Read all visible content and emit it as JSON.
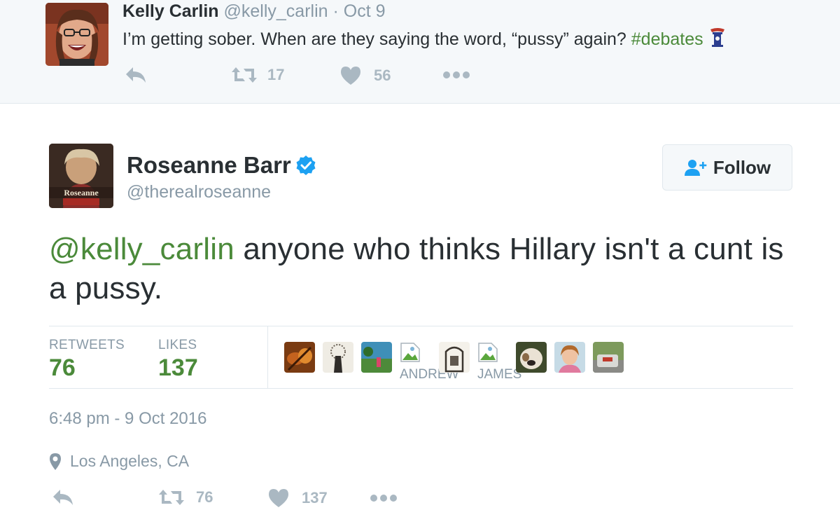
{
  "reply_tweet": {
    "name": "Kelly Carlin",
    "handle": "@kelly_carlin",
    "separator": "·",
    "date": "Oct 9",
    "text": "I’m getting sober.  When are they saying the word, “pussy” again?",
    "hashtag": "#debates",
    "retweet_count": "17",
    "like_count": "56"
  },
  "main_tweet": {
    "name": "Roseanne Barr",
    "handle": "@therealroseanne",
    "follow_label": "Follow",
    "avatar_text": "Roseanne",
    "mention": "@kelly_carlin",
    "text": " anyone who thinks Hillary isn't a cunt is a pussy.",
    "stats": {
      "retweets_label": "RETWEETS",
      "retweets_value": "76",
      "likes_label": "LIKES",
      "likes_value": "137"
    },
    "likers": {
      "name_1": "ANDREW",
      "name_2": "JAMES"
    },
    "timestamp": "6:48 pm - 9 Oct 2016",
    "location": "Los Angeles, CA",
    "retweet_count": "76",
    "like_count": "137"
  },
  "colors": {
    "link_green": "#4b8a3a",
    "muted_gray": "#8899a6",
    "icon_gray": "#aab8c2",
    "verified_blue": "#1da1f2",
    "reply_bg": "#f5f8fa"
  },
  "icons": [
    "reply-icon",
    "retweet-icon",
    "heart-icon",
    "more-icon",
    "verified-icon",
    "follow-person-icon",
    "location-pin-icon",
    "podium-emoji-icon"
  ]
}
